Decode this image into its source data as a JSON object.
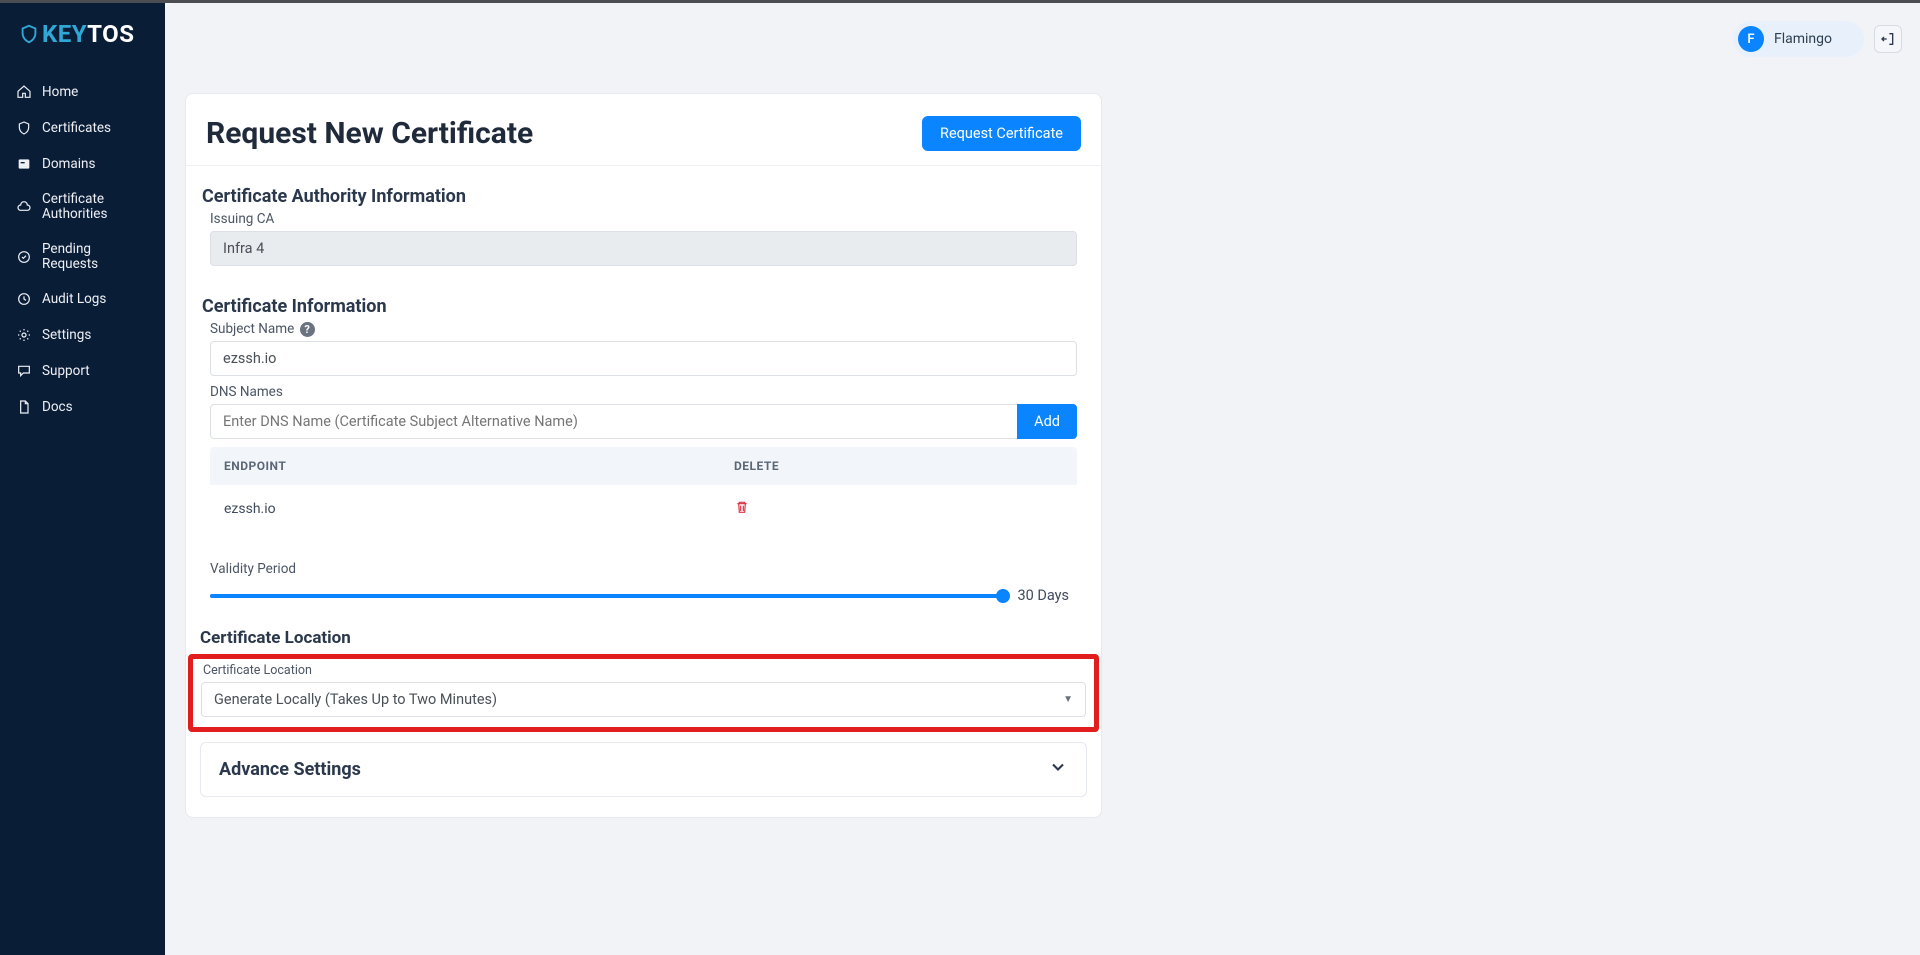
{
  "brand": {
    "key": "KEY",
    "tos": "TOS"
  },
  "sidebar": {
    "items": [
      {
        "label": "Home"
      },
      {
        "label": "Certificates"
      },
      {
        "label": "Domains"
      },
      {
        "label": "Certificate Authorities"
      },
      {
        "label": "Pending Requests"
      },
      {
        "label": "Audit Logs"
      },
      {
        "label": "Settings"
      },
      {
        "label": "Support"
      },
      {
        "label": "Docs"
      }
    ]
  },
  "header": {
    "avatar_initial": "F",
    "user_name": "Flamingo"
  },
  "page": {
    "title": "Request New Certificate",
    "request_button": "Request Certificate"
  },
  "ca_info": {
    "heading": "Certificate Authority Information",
    "issuing_label": "Issuing CA",
    "issuing_value": "Infra 4"
  },
  "cert_info": {
    "heading": "Certificate Information",
    "subject_label": "Subject Name",
    "subject_value": "ezssh.io",
    "dns_label": "DNS Names",
    "dns_placeholder": "Enter DNS Name (Certificate Subject Alternative Name)",
    "add_label": "Add",
    "table": {
      "col_endpoint": "Endpoint",
      "col_delete": "Delete",
      "rows": [
        {
          "endpoint": "ezssh.io"
        }
      ]
    },
    "validity_label": "Validity Period",
    "validity_value": "30 Days"
  },
  "location": {
    "heading": "Certificate Location",
    "label": "Certificate Location",
    "value": "Generate Locally (Takes Up to Two Minutes)"
  },
  "advance": {
    "title": "Advance Settings"
  }
}
